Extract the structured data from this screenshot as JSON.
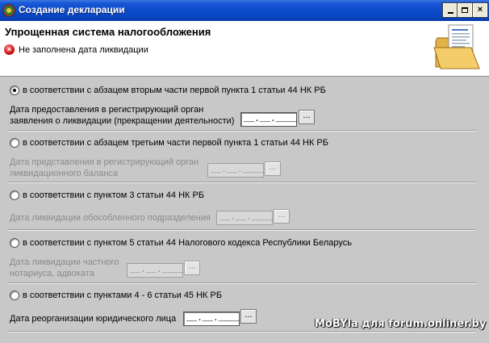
{
  "window": {
    "title": "Создание декларации"
  },
  "titlebar_buttons": {
    "minimize": "minimize",
    "maximize": "maximize",
    "close": "×"
  },
  "header": {
    "title": "Упрощенная система налогообложения",
    "error_message": "Не заполнена дата ликвидации",
    "error_glyph": "×",
    "icon": "folder-document-icon"
  },
  "options": [
    {
      "radio_label": "в соответствии с абзацем вторым части первой пункта 1 статьи 44 НК РБ",
      "checked": true,
      "field_label_lines": [
        "Дата предоставления в регистрирующий орган",
        "заявления о ликвидации (прекращении деятельности)"
      ],
      "date_value": "__.__.____",
      "button_label": "...",
      "enabled": true
    },
    {
      "radio_label": "в соответствии с абзацем третьим части первой пункта 1 статьи 44 НК РБ",
      "checked": false,
      "field_label_lines": [
        "Дата представления в регистрирующий орган",
        "ликвидационного баланса"
      ],
      "date_value": "__.__.____",
      "button_label": "...",
      "enabled": false
    },
    {
      "radio_label": "в соответствии с пунктом 3 статьи 44 НК РБ",
      "checked": false,
      "field_label_lines": [
        "Дата ликвидации обособленного подразделения"
      ],
      "date_value": "__.__.____",
      "button_label": "...",
      "enabled": false
    },
    {
      "radio_label": "в соответствии с пунктом 5 статьи 44 Налогового кодекса Республики Беларусь",
      "checked": false,
      "field_label_lines": [
        "Дата ликвидации частного",
        "нотариуса, адвоката"
      ],
      "date_value": "__.__.____",
      "button_label": "...",
      "enabled": false
    },
    {
      "radio_label": "в соответствии с пунктами 4 - 6 статьи 45 НК РБ",
      "checked": false,
      "field_label_lines": [
        "Дата реорганизации юридического лица"
      ],
      "date_value": "__.__.____",
      "button_label": "...",
      "enabled": true
    }
  ],
  "watermark": "MoBYla для forum.onliner.by",
  "colors": {
    "titlebar": "#0b4bc9",
    "error": "#d01010",
    "background": "#c8c8c8"
  }
}
